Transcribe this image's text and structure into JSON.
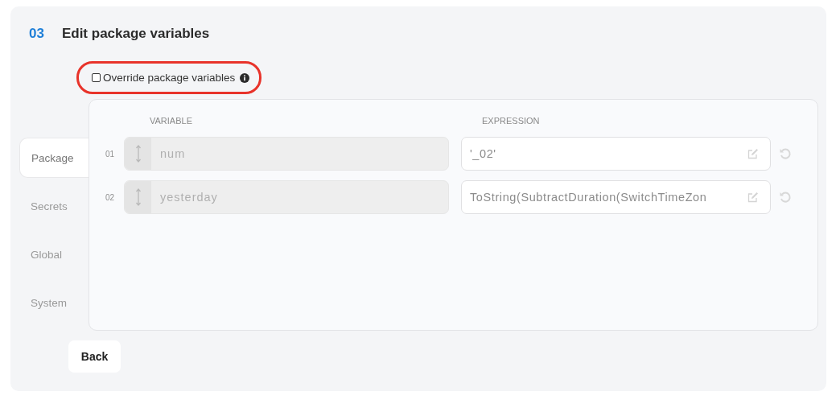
{
  "step": {
    "number": "03",
    "title": "Edit package variables"
  },
  "override": {
    "label": "Override package variables",
    "checked": false,
    "highlighted": true
  },
  "tabs": [
    {
      "label": "Package",
      "selected": true
    },
    {
      "label": "Secrets",
      "selected": false
    },
    {
      "label": "Global",
      "selected": false
    },
    {
      "label": "System",
      "selected": false
    }
  ],
  "table": {
    "columns": [
      "VARIABLE",
      "EXPRESSION"
    ],
    "rows": [
      {
        "index": "01",
        "variable": "num",
        "expression": "'_02'",
        "disabled": true
      },
      {
        "index": "02",
        "variable": "yesterday",
        "expression": "ToString(SubtractDuration(SwitchTimeZon",
        "disabled": true
      }
    ]
  },
  "buttons": [
    "Back"
  ]
}
